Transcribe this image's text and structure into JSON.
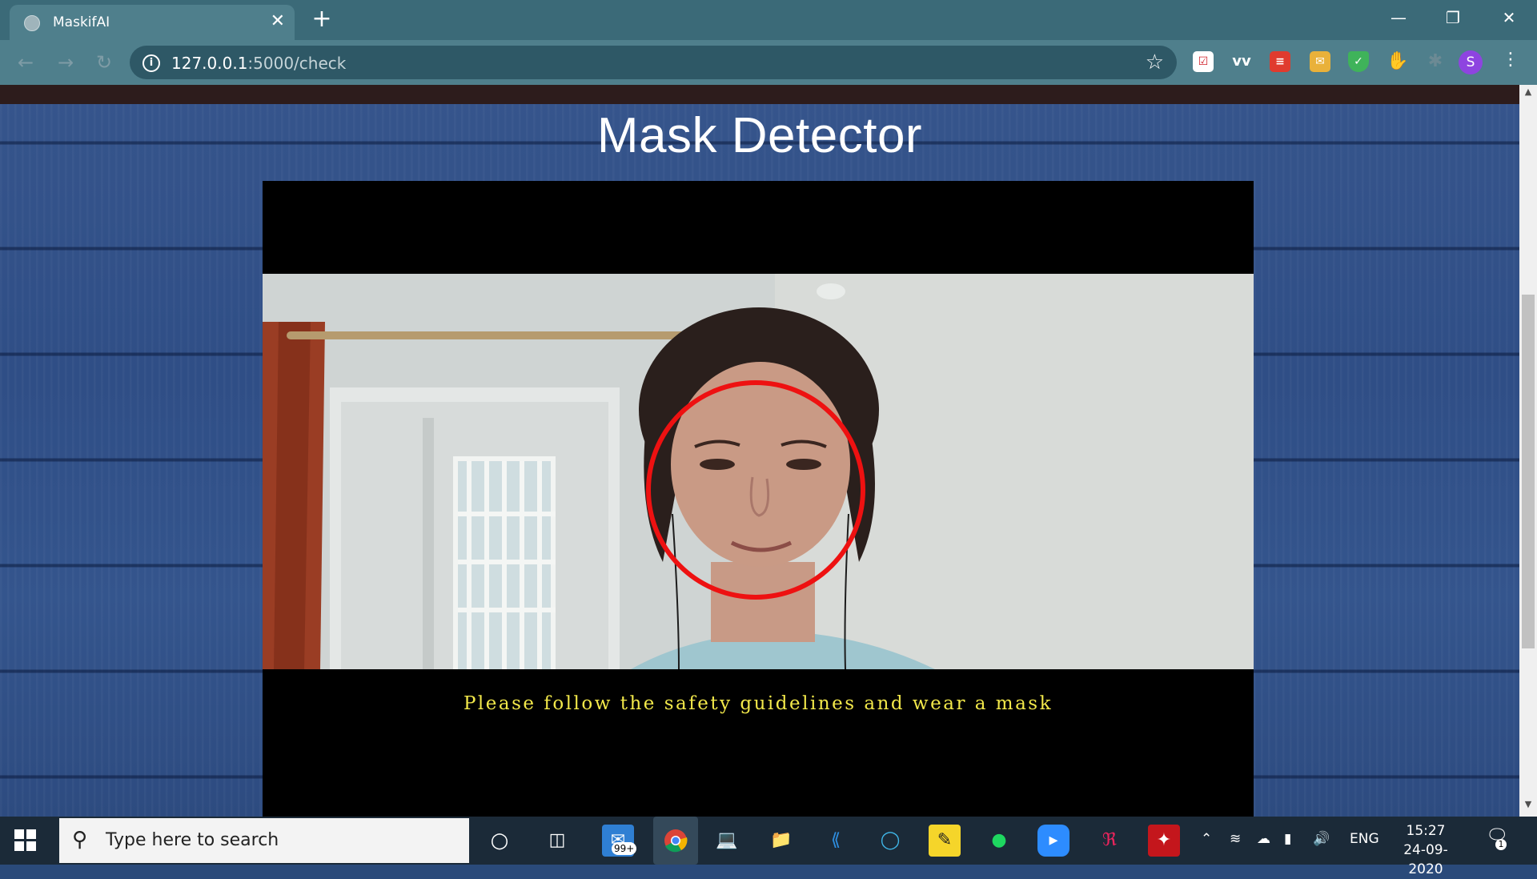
{
  "browser": {
    "tab_title": "MaskifAI",
    "tab_close": "✕",
    "new_tab": "+",
    "url_host": "127.0.0.1",
    "url_rest": ":5000/check",
    "profile_initial": "S",
    "extensions": [
      "pocket-icon",
      "wordtune-icon",
      "todoist-icon",
      "mail-ext-icon",
      "shield-ext-icon",
      "thumbs-up-icon",
      "extensions-puzzle-icon"
    ]
  },
  "page": {
    "title": "Mask Detector",
    "video_caption": "Please follow the safety guidelines and wear a mask",
    "detection_ring_color": "#ee1111"
  },
  "taskbar": {
    "search_placeholder": "Type here to search",
    "mail_badge": "99+",
    "language": "ENG",
    "time": "15:27",
    "date": "24-09-2020",
    "notification_count": "1"
  }
}
